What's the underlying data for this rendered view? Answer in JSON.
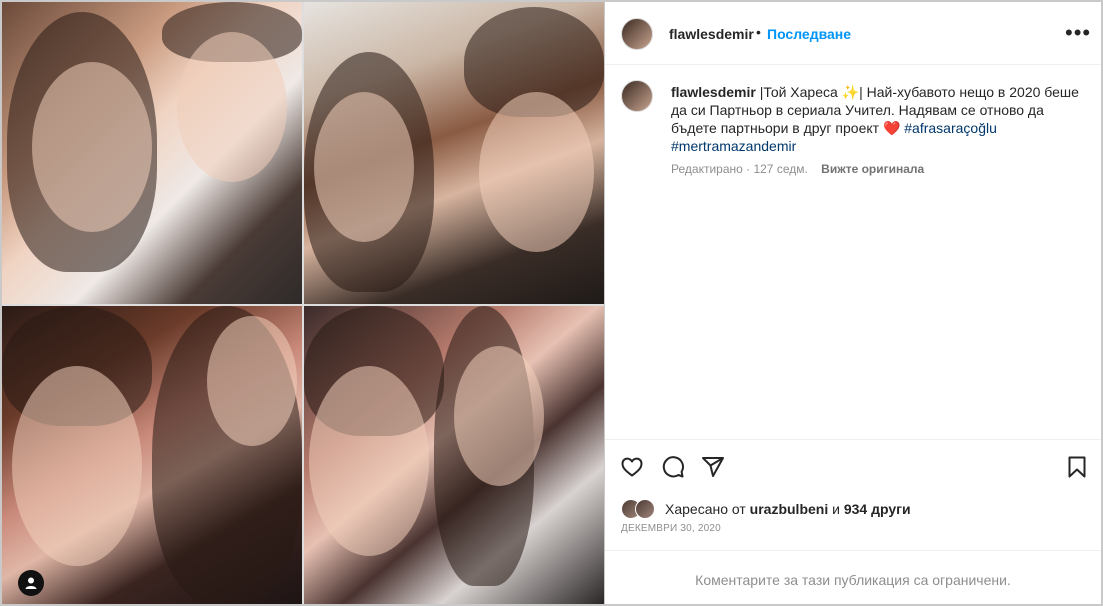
{
  "post": {
    "username": "flawlesdemir",
    "follow_label": "Последване",
    "more_label": "•••",
    "caption": {
      "username": "flawlesdemir",
      "text_before": "|Той Хареса",
      "sparkle": "✨",
      "text_main": "| Най-хубавото нещо в 2020 беше да си Партньор в сериала Учител. Надявам се отново да бъдете партньори в друг проект",
      "heart": "❤️",
      "hashtag1": "#afrasaraçoğlu",
      "hashtag2": "#mertramazandemir"
    },
    "meta": {
      "edited": "Редактирано · 127 седм.",
      "see_original": "Вижте оригинала"
    },
    "likes": {
      "prefix": "Харесано от",
      "liker": "urazbulbeni",
      "conj": "и",
      "others": "934 други"
    },
    "date": "ДЕКЕМВРИ 30, 2020",
    "comments_restricted": "Коментарите за тази публикация са ограничени."
  },
  "icons": {
    "like": "heart-icon",
    "comment": "comment-icon",
    "share": "share-icon",
    "save": "bookmark-icon",
    "tagged": "user-tag-icon"
  },
  "colors": {
    "link": "#0095f6",
    "hashtag": "#00376b",
    "muted": "#8e8e8e",
    "heart": "#ed4956"
  }
}
